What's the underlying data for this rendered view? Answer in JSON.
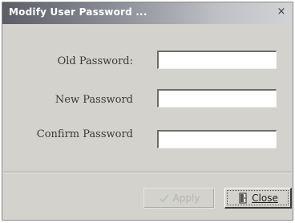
{
  "window": {
    "title": "Modify User Password ...",
    "close_glyph": "×"
  },
  "form": {
    "old_password_label": "Old Password:",
    "old_password_value": "",
    "new_password_label": "New Password",
    "new_password_value": "",
    "confirm_password_label": "Confirm Password",
    "confirm_password_value": ""
  },
  "buttons": {
    "apply_label": "Apply",
    "apply_icon": "checkmark-icon",
    "apply_enabled": false,
    "close_label": "Close",
    "close_icon": "door-icon"
  }
}
